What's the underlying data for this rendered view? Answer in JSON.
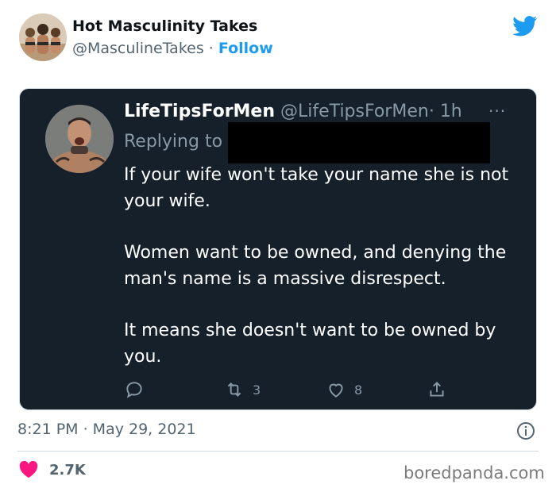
{
  "author": {
    "display_name": "Hot Masculinity Takes",
    "handle": "@MasculineTakes",
    "separator": "·",
    "follow_label": "Follow"
  },
  "embedded_tweet": {
    "name": "LifeTipsForMen",
    "handle": "@LifeTipsForMen",
    "time": "· 1h",
    "more": "···",
    "replying_to": "Replying to",
    "body": [
      "If your wife won't take your name she is not your wife.",
      "Women want to be owned, and denying the man's name is a massive disrespect.",
      "It means she doesn't want to be owned by you."
    ],
    "actions": {
      "reply_icon": "reply-icon",
      "retweet_icon": "retweet-icon",
      "retweets": "3",
      "like_icon": "heart-outline-icon",
      "likes": "8",
      "share_icon": "share-icon"
    }
  },
  "timestamp": "8:21 PM · May 29, 2021",
  "likes": "2.7K",
  "watermark": "boredpanda.com",
  "colors": {
    "brand_blue": "#1d9bf0",
    "dark_bg": "#15202b",
    "like_red": "#f91880",
    "muted": "#536471"
  }
}
